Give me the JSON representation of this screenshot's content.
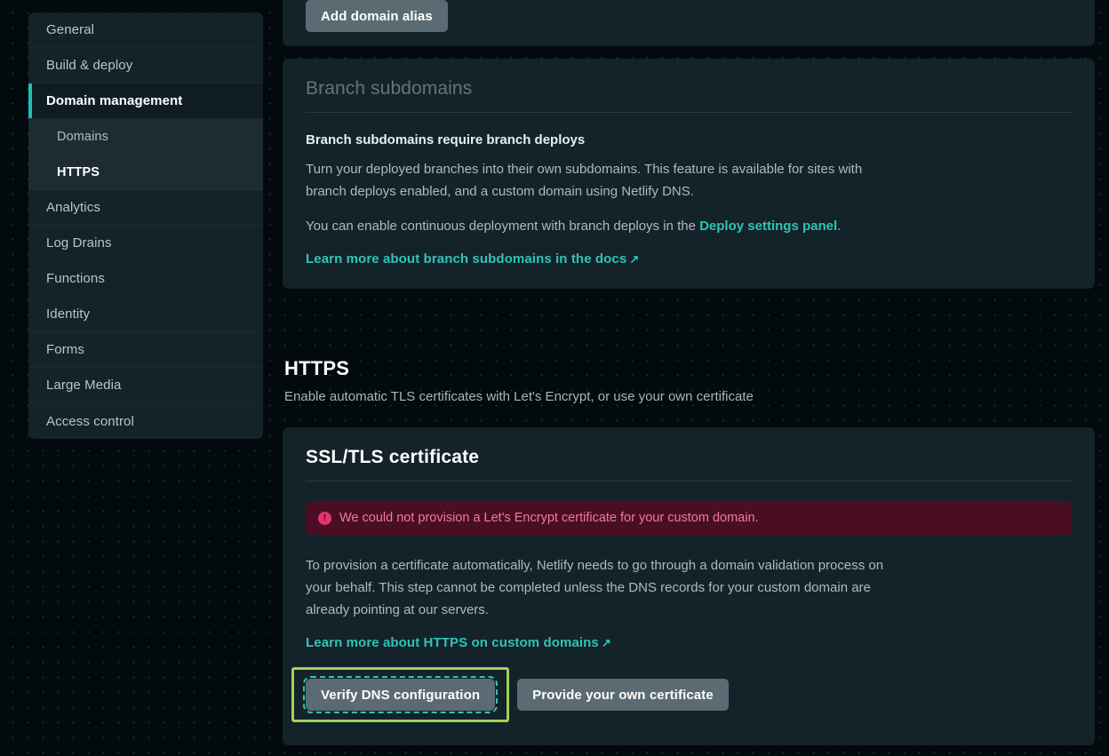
{
  "sidebar": {
    "items": [
      {
        "label": "General",
        "state": "normal"
      },
      {
        "label": "Build & deploy",
        "state": "normal"
      },
      {
        "label": "Domain management",
        "state": "active-parent"
      },
      {
        "label": "Domains",
        "state": "sub"
      },
      {
        "label": "HTTPS",
        "state": "sub-current"
      },
      {
        "label": "Analytics",
        "state": "normal"
      },
      {
        "label": "Log Drains",
        "state": "normal"
      },
      {
        "label": "Functions",
        "state": "normal"
      },
      {
        "label": "Identity",
        "state": "normal"
      },
      {
        "label": "Forms",
        "state": "normal"
      },
      {
        "label": "Large Media",
        "state": "normal"
      },
      {
        "label": "Access control",
        "state": "normal"
      }
    ]
  },
  "top_card": {
    "add_domain_alias_label": "Add domain alias"
  },
  "branch_subdomains": {
    "title": "Branch subdomains",
    "subtitle": "Branch subdomains require branch deploys",
    "paragraph1": "Turn your deployed branches into their own subdomains. This feature is available for sites with branch deploys enabled, and a custom domain using Netlify DNS.",
    "paragraph2_prefix": "You can enable continuous deployment with branch deploys in the ",
    "paragraph2_link": "Deploy settings panel",
    "paragraph2_suffix": ".",
    "doc_link": "Learn more about branch subdomains in the docs",
    "external_arrow": "↗"
  },
  "https_section": {
    "title": "HTTPS",
    "subtitle": "Enable automatic TLS certificates with Let's Encrypt, or use your own certificate"
  },
  "ssl_card": {
    "title": "SSL/TLS certificate",
    "alert_icon": "alert-circle-icon",
    "alert_glyph": "!",
    "alert_text": "We could not provision a Let's Encrypt certificate for your custom domain.",
    "paragraph": "To provision a certificate automatically, Netlify needs to go through a domain validation process on your behalf. This step cannot be completed unless the DNS records for your custom domain are already pointing at our servers.",
    "doc_link": "Learn more about HTTPS on custom domains",
    "external_arrow": "↗",
    "verify_button_label": "Verify DNS configuration",
    "provide_button_label": "Provide your own certificate"
  },
  "colors": {
    "page_background": "#020a0d",
    "card_background": "#14222a",
    "accent_teal": "#2ec4b6",
    "focus_highlight_green": "#9ed356",
    "alert_background": "#4a0e24",
    "alert_text": "#ee7aa1",
    "alert_icon": "#e8336d",
    "button_grey": "#5c6b73"
  }
}
